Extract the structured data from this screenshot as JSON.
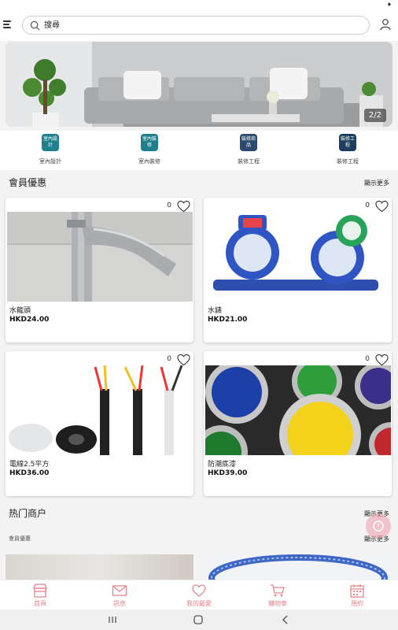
{
  "status_bar": {
    "indicator": "♦"
  },
  "header": {
    "menu_icon": "hamburger-icon",
    "search_placeholder": "搜尋",
    "user_icon": "user-icon"
  },
  "banner": {
    "counter": "2/2"
  },
  "categories": [
    {
      "icon_text": "室內設計",
      "label": "室內設計",
      "color": "#1f7f8c"
    },
    {
      "icon_text": "室內裝修",
      "label": "室內裝修",
      "color": "#1f7f8c"
    },
    {
      "icon_text": "裝修商品",
      "label": "裝修工程",
      "color": "#2c4a6e"
    },
    {
      "icon_text": "裝修工程",
      "label": "裝修工程",
      "color": "#1d3d5e"
    }
  ],
  "member_section": {
    "title": "會員優惠",
    "more": "顯示更多"
  },
  "products": [
    {
      "name": "水龍頭",
      "price": "HKD24.00",
      "likes": "0"
    },
    {
      "name": "水錶",
      "price": "HKD21.00",
      "likes": "0"
    },
    {
      "name": "電線2.5平方",
      "price": "HKD36.00",
      "likes": "0"
    },
    {
      "name": "防潮底漆",
      "price": "HKD39.00",
      "likes": "0"
    }
  ],
  "hot_section": {
    "title": "热门商户",
    "more": "顯示更多",
    "sub_label": "會員優惠",
    "more2": "顯示更多"
  },
  "bottom_nav": [
    {
      "label": "首頁",
      "icon": "store-icon"
    },
    {
      "label": "訊息",
      "icon": "mail-icon"
    },
    {
      "label": "我的最愛",
      "icon": "heart-icon"
    },
    {
      "label": "購物車",
      "icon": "cart-icon"
    },
    {
      "label": "預約",
      "icon": "calendar-icon"
    }
  ],
  "colors": {
    "accent": "#e8848d",
    "teal": "#1f7f8c",
    "navy": "#2c4a6e"
  }
}
